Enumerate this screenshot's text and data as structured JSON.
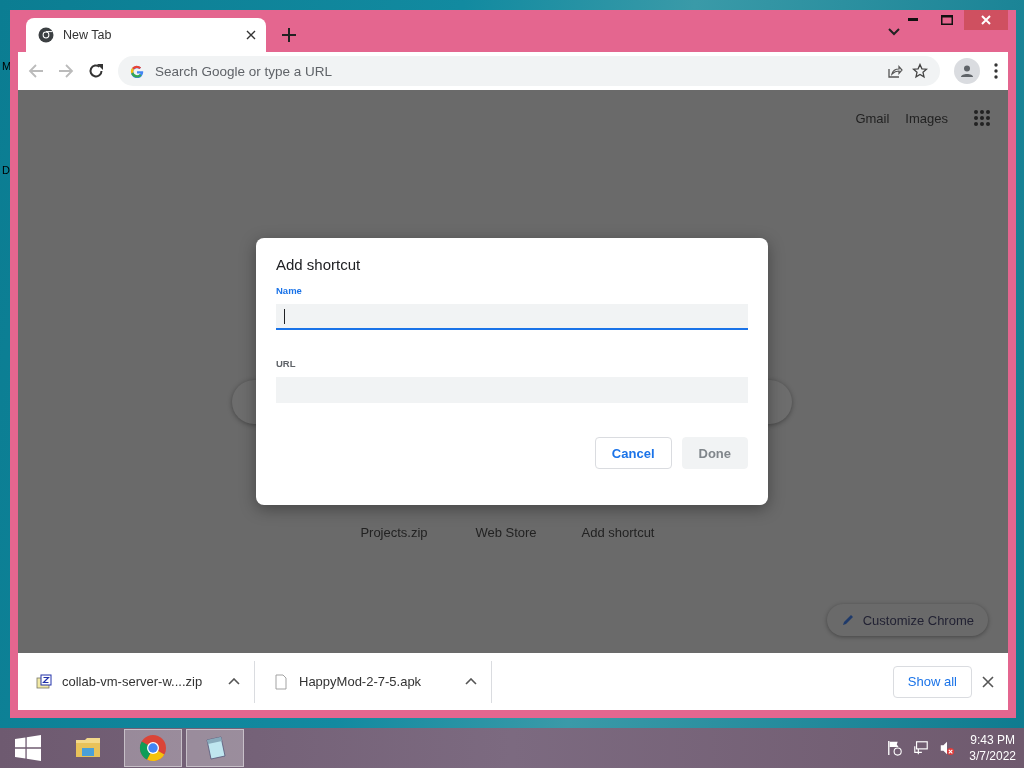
{
  "desktop": {
    "icon_labels": [
      "M",
      "D"
    ]
  },
  "browser": {
    "tabs": [
      {
        "title": "New Tab",
        "selected": true
      }
    ],
    "address_bar": {
      "placeholder": "Search Google or type a URL"
    },
    "new_tab_page": {
      "header_links": [
        "Gmail",
        "Images"
      ],
      "shortcuts": [
        "Projects.zip",
        "Web Store",
        "Add shortcut"
      ],
      "customize_button": "Customize Chrome"
    },
    "dialog": {
      "title": "Add shortcut",
      "fields": [
        {
          "label": "Name",
          "focused": true
        },
        {
          "label": "URL",
          "focused": false
        }
      ],
      "buttons": [
        {
          "label": "Cancel",
          "disabled": false
        },
        {
          "label": "Done",
          "disabled": true
        }
      ]
    },
    "downloads": {
      "items": [
        {
          "name": "collab-vm-server-w....zip",
          "kind": "archive"
        },
        {
          "name": "HappyMod-2-7-5.apk",
          "kind": "file"
        }
      ],
      "show_all": "Show all"
    }
  },
  "taskbar": {
    "apps": [
      {
        "kind": "folder",
        "open": false
      },
      {
        "kind": "chrome",
        "open": true
      },
      {
        "kind": "notepad",
        "open": true
      }
    ],
    "time": "9:43 PM",
    "date": "3/7/2022"
  }
}
